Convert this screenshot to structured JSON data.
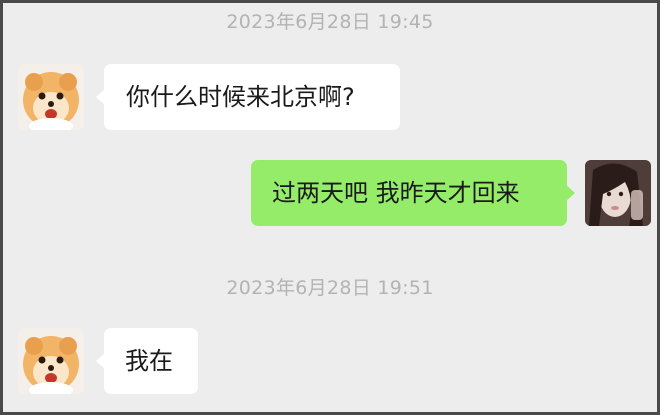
{
  "chat": {
    "timestamps": [
      "2023年6月28日 19:45",
      "2023年6月28日 19:51"
    ],
    "messages": [
      {
        "sender": "contact",
        "text": "你什么时候来北京啊?"
      },
      {
        "sender": "self",
        "text": "过两天吧 我昨天才回来"
      },
      {
        "sender": "contact",
        "text": "我在"
      }
    ],
    "avatars": {
      "contact": "pomeranian-dog-avatar",
      "self": "girl-portrait-avatar"
    }
  },
  "colors": {
    "background": "#ededed",
    "incoming_bubble": "#ffffff",
    "outgoing_bubble": "#95ec69",
    "timestamp_text": "#b3b3b3"
  }
}
